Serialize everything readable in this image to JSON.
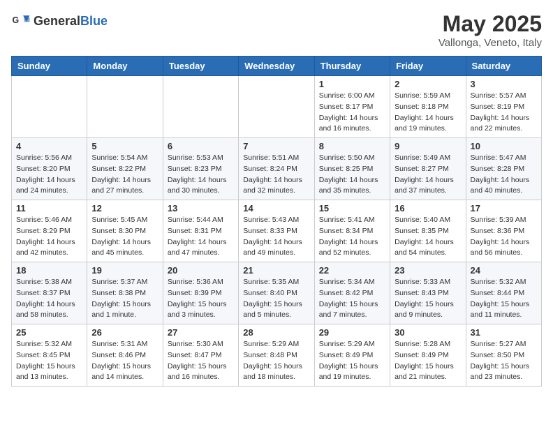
{
  "header": {
    "logo_general": "General",
    "logo_blue": "Blue",
    "title": "May 2025",
    "location": "Vallonga, Veneto, Italy"
  },
  "days_of_week": [
    "Sunday",
    "Monday",
    "Tuesday",
    "Wednesday",
    "Thursday",
    "Friday",
    "Saturday"
  ],
  "weeks": [
    [
      {
        "day": "",
        "info": ""
      },
      {
        "day": "",
        "info": ""
      },
      {
        "day": "",
        "info": ""
      },
      {
        "day": "",
        "info": ""
      },
      {
        "day": "1",
        "info": "Sunrise: 6:00 AM\nSunset: 8:17 PM\nDaylight: 14 hours and 16 minutes."
      },
      {
        "day": "2",
        "info": "Sunrise: 5:59 AM\nSunset: 8:18 PM\nDaylight: 14 hours and 19 minutes."
      },
      {
        "day": "3",
        "info": "Sunrise: 5:57 AM\nSunset: 8:19 PM\nDaylight: 14 hours and 22 minutes."
      }
    ],
    [
      {
        "day": "4",
        "info": "Sunrise: 5:56 AM\nSunset: 8:20 PM\nDaylight: 14 hours and 24 minutes."
      },
      {
        "day": "5",
        "info": "Sunrise: 5:54 AM\nSunset: 8:22 PM\nDaylight: 14 hours and 27 minutes."
      },
      {
        "day": "6",
        "info": "Sunrise: 5:53 AM\nSunset: 8:23 PM\nDaylight: 14 hours and 30 minutes."
      },
      {
        "day": "7",
        "info": "Sunrise: 5:51 AM\nSunset: 8:24 PM\nDaylight: 14 hours and 32 minutes."
      },
      {
        "day": "8",
        "info": "Sunrise: 5:50 AM\nSunset: 8:25 PM\nDaylight: 14 hours and 35 minutes."
      },
      {
        "day": "9",
        "info": "Sunrise: 5:49 AM\nSunset: 8:27 PM\nDaylight: 14 hours and 37 minutes."
      },
      {
        "day": "10",
        "info": "Sunrise: 5:47 AM\nSunset: 8:28 PM\nDaylight: 14 hours and 40 minutes."
      }
    ],
    [
      {
        "day": "11",
        "info": "Sunrise: 5:46 AM\nSunset: 8:29 PM\nDaylight: 14 hours and 42 minutes."
      },
      {
        "day": "12",
        "info": "Sunrise: 5:45 AM\nSunset: 8:30 PM\nDaylight: 14 hours and 45 minutes."
      },
      {
        "day": "13",
        "info": "Sunrise: 5:44 AM\nSunset: 8:31 PM\nDaylight: 14 hours and 47 minutes."
      },
      {
        "day": "14",
        "info": "Sunrise: 5:43 AM\nSunset: 8:33 PM\nDaylight: 14 hours and 49 minutes."
      },
      {
        "day": "15",
        "info": "Sunrise: 5:41 AM\nSunset: 8:34 PM\nDaylight: 14 hours and 52 minutes."
      },
      {
        "day": "16",
        "info": "Sunrise: 5:40 AM\nSunset: 8:35 PM\nDaylight: 14 hours and 54 minutes."
      },
      {
        "day": "17",
        "info": "Sunrise: 5:39 AM\nSunset: 8:36 PM\nDaylight: 14 hours and 56 minutes."
      }
    ],
    [
      {
        "day": "18",
        "info": "Sunrise: 5:38 AM\nSunset: 8:37 PM\nDaylight: 14 hours and 58 minutes."
      },
      {
        "day": "19",
        "info": "Sunrise: 5:37 AM\nSunset: 8:38 PM\nDaylight: 15 hours and 1 minute."
      },
      {
        "day": "20",
        "info": "Sunrise: 5:36 AM\nSunset: 8:39 PM\nDaylight: 15 hours and 3 minutes."
      },
      {
        "day": "21",
        "info": "Sunrise: 5:35 AM\nSunset: 8:40 PM\nDaylight: 15 hours and 5 minutes."
      },
      {
        "day": "22",
        "info": "Sunrise: 5:34 AM\nSunset: 8:42 PM\nDaylight: 15 hours and 7 minutes."
      },
      {
        "day": "23",
        "info": "Sunrise: 5:33 AM\nSunset: 8:43 PM\nDaylight: 15 hours and 9 minutes."
      },
      {
        "day": "24",
        "info": "Sunrise: 5:32 AM\nSunset: 8:44 PM\nDaylight: 15 hours and 11 minutes."
      }
    ],
    [
      {
        "day": "25",
        "info": "Sunrise: 5:32 AM\nSunset: 8:45 PM\nDaylight: 15 hours and 13 minutes."
      },
      {
        "day": "26",
        "info": "Sunrise: 5:31 AM\nSunset: 8:46 PM\nDaylight: 15 hours and 14 minutes."
      },
      {
        "day": "27",
        "info": "Sunrise: 5:30 AM\nSunset: 8:47 PM\nDaylight: 15 hours and 16 minutes."
      },
      {
        "day": "28",
        "info": "Sunrise: 5:29 AM\nSunset: 8:48 PM\nDaylight: 15 hours and 18 minutes."
      },
      {
        "day": "29",
        "info": "Sunrise: 5:29 AM\nSunset: 8:49 PM\nDaylight: 15 hours and 19 minutes."
      },
      {
        "day": "30",
        "info": "Sunrise: 5:28 AM\nSunset: 8:49 PM\nDaylight: 15 hours and 21 minutes."
      },
      {
        "day": "31",
        "info": "Sunrise: 5:27 AM\nSunset: 8:50 PM\nDaylight: 15 hours and 23 minutes."
      }
    ]
  ]
}
